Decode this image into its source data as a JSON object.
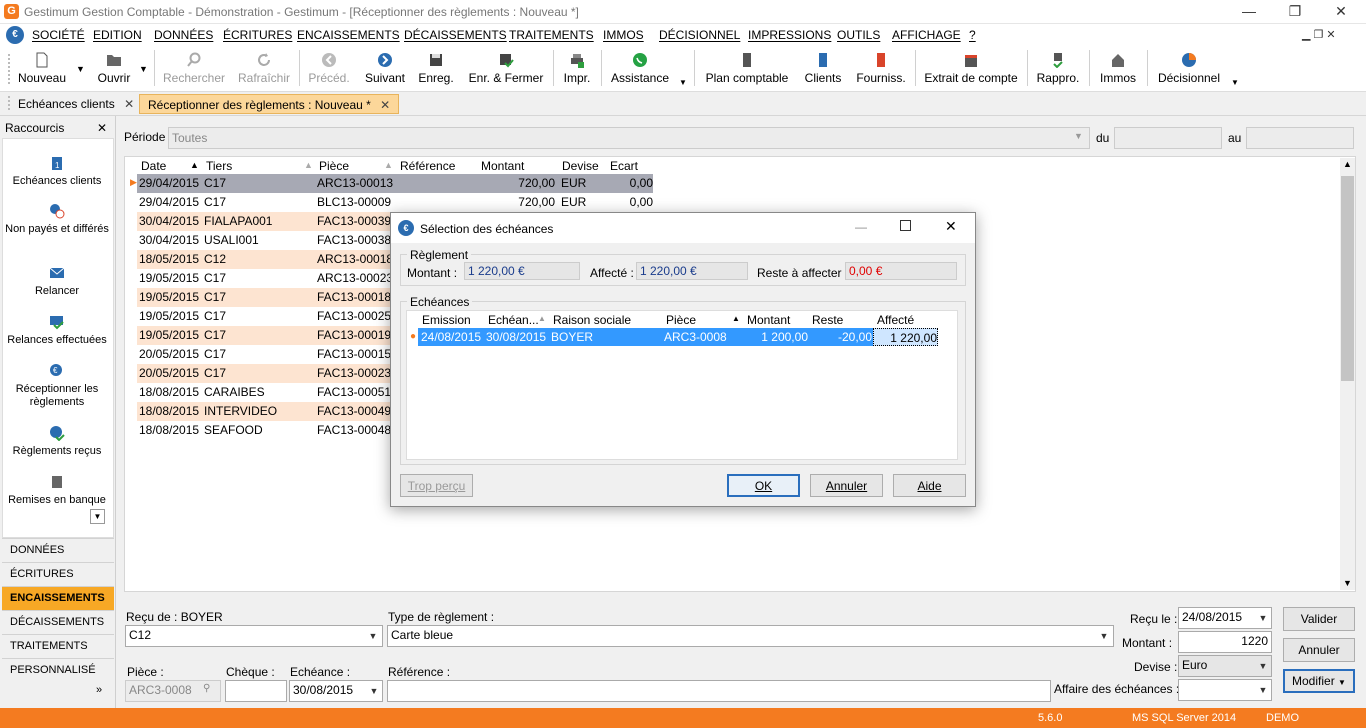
{
  "window": {
    "title": "Gestimum Gestion Comptable - Démonstration - Gestimum - [Réceptionner des règlements : Nouveau *]"
  },
  "menu": [
    "SOCIÉTÉ",
    "EDITION",
    "DONNÉES",
    "ÉCRITURES",
    "ENCAISSEMENTS",
    "DÉCAISSEMENTS",
    "TRAITEMENTS",
    "IMMOS",
    "DÉCISIONNEL",
    "IMPRESSIONS",
    "OUTILS",
    "AFFICHAGE",
    "?"
  ],
  "toolbar": {
    "nouveau": "Nouveau",
    "ouvrir": "Ouvrir",
    "rechercher": "Rechercher",
    "rafraichir": "Rafraîchir",
    "preced": "Précéd.",
    "suivant": "Suivant",
    "enreg": "Enreg.",
    "enr_fermer": "Enr. & Fermer",
    "impr": "Impr.",
    "assistance": "Assistance",
    "plan": "Plan comptable",
    "clients": "Clients",
    "fourniss": "Fourniss.",
    "extrait": "Extrait de compte",
    "rappro": "Rappro.",
    "immos": "Immos",
    "decisionnel": "Décisionnel"
  },
  "tabs": {
    "t1": "Echéances clients",
    "t2": "Réceptionner des règlements : Nouveau *"
  },
  "sidebar": {
    "title": "Raccourcis",
    "shortcuts": [
      "Echéances clients",
      "Non payés et différés",
      "Relancer",
      "Relances effectuées",
      "Réceptionner les règlements",
      "Règlements reçus",
      "Remises en banque"
    ],
    "nav": [
      "DONNÉES",
      "ÉCRITURES",
      "ENCAISSEMENTS",
      "DÉCAISSEMENTS",
      "TRAITEMENTS",
      "PERSONNALISÉ"
    ]
  },
  "filter": {
    "periode_label": "Période",
    "periode_value": "Toutes",
    "du_label": "du",
    "au_label": "au"
  },
  "grid": {
    "headers": [
      "Date",
      "Tiers",
      "Pièce",
      "Référence",
      "Montant",
      "Devise",
      "Ecart"
    ],
    "rows": [
      [
        "29/04/2015",
        "C17",
        "ARC13-00013",
        "",
        "720,00",
        "EUR",
        "0,00"
      ],
      [
        "29/04/2015",
        "C17",
        "BLC13-00009",
        "",
        "720,00",
        "EUR",
        "0,00"
      ],
      [
        "30/04/2015",
        "FIALAPA001",
        "FAC13-00039",
        "",
        "",
        "",
        ""
      ],
      [
        "30/04/2015",
        "USALI001",
        "FAC13-00038",
        "",
        "",
        "",
        ""
      ],
      [
        "18/05/2015",
        "C12",
        "ARC13-00018",
        "",
        "",
        "",
        ""
      ],
      [
        "19/05/2015",
        "C17",
        "ARC13-00023",
        "",
        "",
        "",
        ""
      ],
      [
        "19/05/2015",
        "C17",
        "FAC13-00018",
        "",
        "",
        "",
        ""
      ],
      [
        "19/05/2015",
        "C17",
        "FAC13-00025",
        "",
        "",
        "",
        ""
      ],
      [
        "19/05/2015",
        "C17",
        "FAC13-00019",
        "",
        "",
        "",
        ""
      ],
      [
        "20/05/2015",
        "C17",
        "FAC13-00015",
        "",
        "",
        "",
        ""
      ],
      [
        "20/05/2015",
        "C17",
        "FAC13-00023",
        "",
        "",
        "",
        ""
      ],
      [
        "18/08/2015",
        "CARAIBES",
        "FAC13-00051",
        "",
        "",
        "",
        ""
      ],
      [
        "18/08/2015",
        "INTERVIDEO",
        "FAC13-00049",
        "",
        "",
        "",
        ""
      ],
      [
        "18/08/2015",
        "SEAFOOD",
        "FAC13-00048",
        "",
        "",
        "",
        ""
      ]
    ]
  },
  "dialog": {
    "title": "Sélection des échéances",
    "reglement_group": "Règlement",
    "montant_label": "Montant :",
    "montant_value": "1 220,00 €",
    "affecte_label": "Affecté :",
    "affecte_value": "1 220,00 €",
    "reste_label": "Reste à affecter :",
    "reste_value": "0,00 €",
    "echeances_group": "Echéances",
    "headers": [
      "Emission",
      "Echéan...",
      "Raison sociale",
      "Pièce",
      "Montant",
      "Reste",
      "Affecté"
    ],
    "row": [
      "24/08/2015",
      "30/08/2015",
      "BOYER",
      "ARC3-0008",
      "1 200,00",
      "-20,00",
      "1 220,00"
    ],
    "trop_percu": "Trop perçu",
    "ok": "OK",
    "annuler": "Annuler",
    "aide": "Aide"
  },
  "form": {
    "recu_de_label": "Reçu de : BOYER",
    "client_value": "C12",
    "type_label": "Type de règlement :",
    "type_value": "Carte bleue",
    "piece_label": "Pièce :",
    "piece_value": "ARC3-0008",
    "cheque_label": "Chèque :",
    "cheque_value": "",
    "echeance_label": "Echéance :",
    "echeance_value": "30/08/2015",
    "reference_label": "Référence :",
    "reference_value": "",
    "recu_le_label": "Reçu le :",
    "recu_le_value": "24/08/2015",
    "montant_label": "Montant :",
    "montant_value": "1220",
    "devise_label": "Devise :",
    "devise_value": "Euro",
    "affaire_label": "Affaire des échéances :",
    "affaire_value": "",
    "valider": "Valider",
    "annuler": "Annuler",
    "modifier": "Modifier"
  },
  "status": {
    "version": "5.6.0",
    "server": "MS SQL Server 2014",
    "db": "DEMO"
  },
  "colors": {
    "accent": "#f47b20",
    "active_nav": "#f7a825",
    "selection": "#3399ff",
    "alt_row": "#fde4d1"
  }
}
